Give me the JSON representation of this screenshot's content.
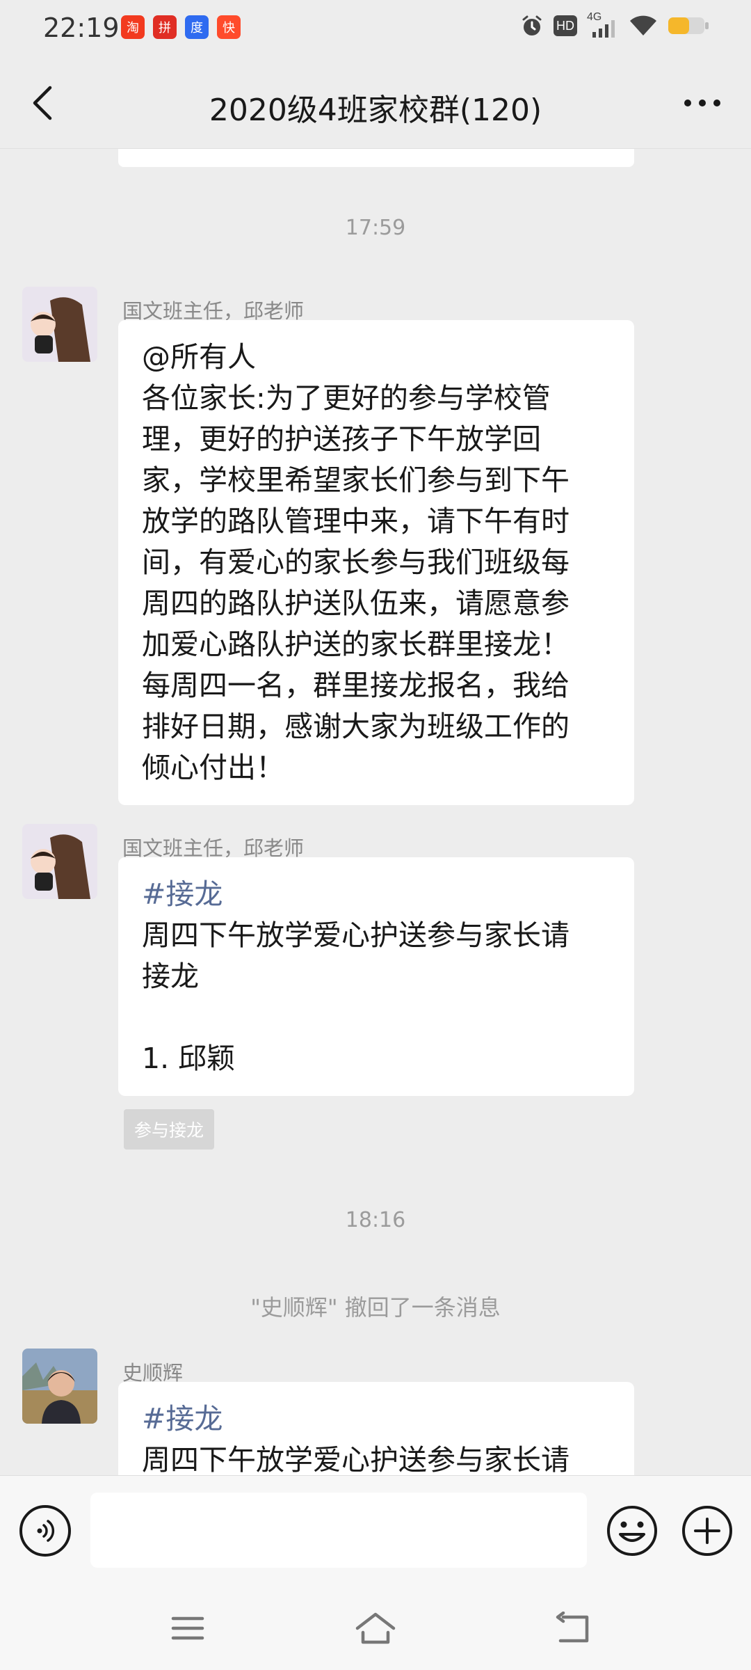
{
  "status_bar": {
    "time": "22:19",
    "notification_icons": [
      {
        "name": "taobao-app-icon",
        "glyph": "淘",
        "color": "#f23a1f"
      },
      {
        "name": "pinduoduo-app-icon",
        "glyph": "拼",
        "color": "#e02e24"
      },
      {
        "name": "baidu-app-icon",
        "glyph": "度",
        "color": "#2f6bf0"
      },
      {
        "name": "kuaishou-app-icon",
        "glyph": "快",
        "color": "#ff4b2b"
      }
    ],
    "network_label": "4G",
    "hd_label": "HD"
  },
  "header": {
    "title": "2020级4班家校群(120)"
  },
  "chat": {
    "time_1": "17:59",
    "msg_1": {
      "sender": "国文班主任，邱老师",
      "lines": [
        "@所有人",
        "各位家长:为了更好的参与学校管",
        "理，更好的护送孩子下午放学回",
        "家，学校里希望家长们参与到下午",
        "放学的路队管理中来，请下午有时",
        "间，有爱心的家长参与我们班级每",
        "周四的路队护送队伍来，请愿意参",
        "加爱心路队护送的家长群里接龙！",
        "每周四一名，群里接龙报名，我给",
        "排好日期，感谢大家为班级工作的",
        "倾心付出！"
      ]
    },
    "msg_2": {
      "sender": "国文班主任，邱老师",
      "tag": "#接龙",
      "line_1": "周四下午放学爱心护送参与家长请",
      "line_2": "接龙",
      "entry_1": "1. 邱颖",
      "join_button": "参与接龙"
    },
    "time_2": "18:16",
    "recall_notice": "\"史顺辉\" 撤回了一条消息",
    "msg_3": {
      "sender": "史顺辉",
      "tag": "#接龙",
      "line_1": "周四下午放学爱心护送参与家长请"
    }
  },
  "input": {
    "placeholder": ""
  },
  "colors": {
    "background": "#ededed",
    "bubble": "#ffffff",
    "link_tag": "#576b95",
    "meta_text": "#9b9b9b",
    "battery": "#f5b72b"
  }
}
